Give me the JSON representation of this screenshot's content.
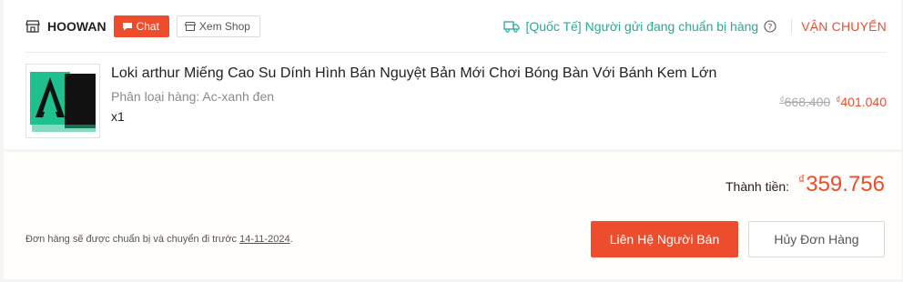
{
  "shop": {
    "name": "HOOWAN",
    "chat_label": "Chat",
    "view_shop_label": "Xem Shop",
    "store_icon": "store-icon",
    "chat_icon": "chat-bubble-icon"
  },
  "shipping": {
    "status_text": "[Quốc Tế] Người gửi đang chuẩn bị hàng",
    "label": "VẬN CHUYỂN",
    "truck_icon": "truck-icon",
    "help_icon": "help-circle-icon",
    "status_color": "#26aa99",
    "label_color": "#ee4d2d"
  },
  "product": {
    "name": "Loki arthur Miếng Cao Su Dính Hình Bán Nguyệt Bản Mới Chơi Bóng Bàn Với Bánh Kem Lớn",
    "variant": "Phân loại hàng: Ac-xanh đen",
    "quantity": "x1",
    "currency_symbol": "₫",
    "original_price": "668.400",
    "sale_price": "401.040"
  },
  "order": {
    "total_label": "Thành tiền:",
    "currency_symbol": "₫",
    "total_value": "359.756",
    "note_prefix": "Đơn hàng sẽ được chuẩn bị và chuyển đi trước",
    "note_date": "14-11-2024",
    "note_suffix": ".",
    "contact_button": "Liên Hệ Người Bán",
    "cancel_button": "Hủy Đơn Hàng",
    "accent_color": "#ee4d2d"
  }
}
